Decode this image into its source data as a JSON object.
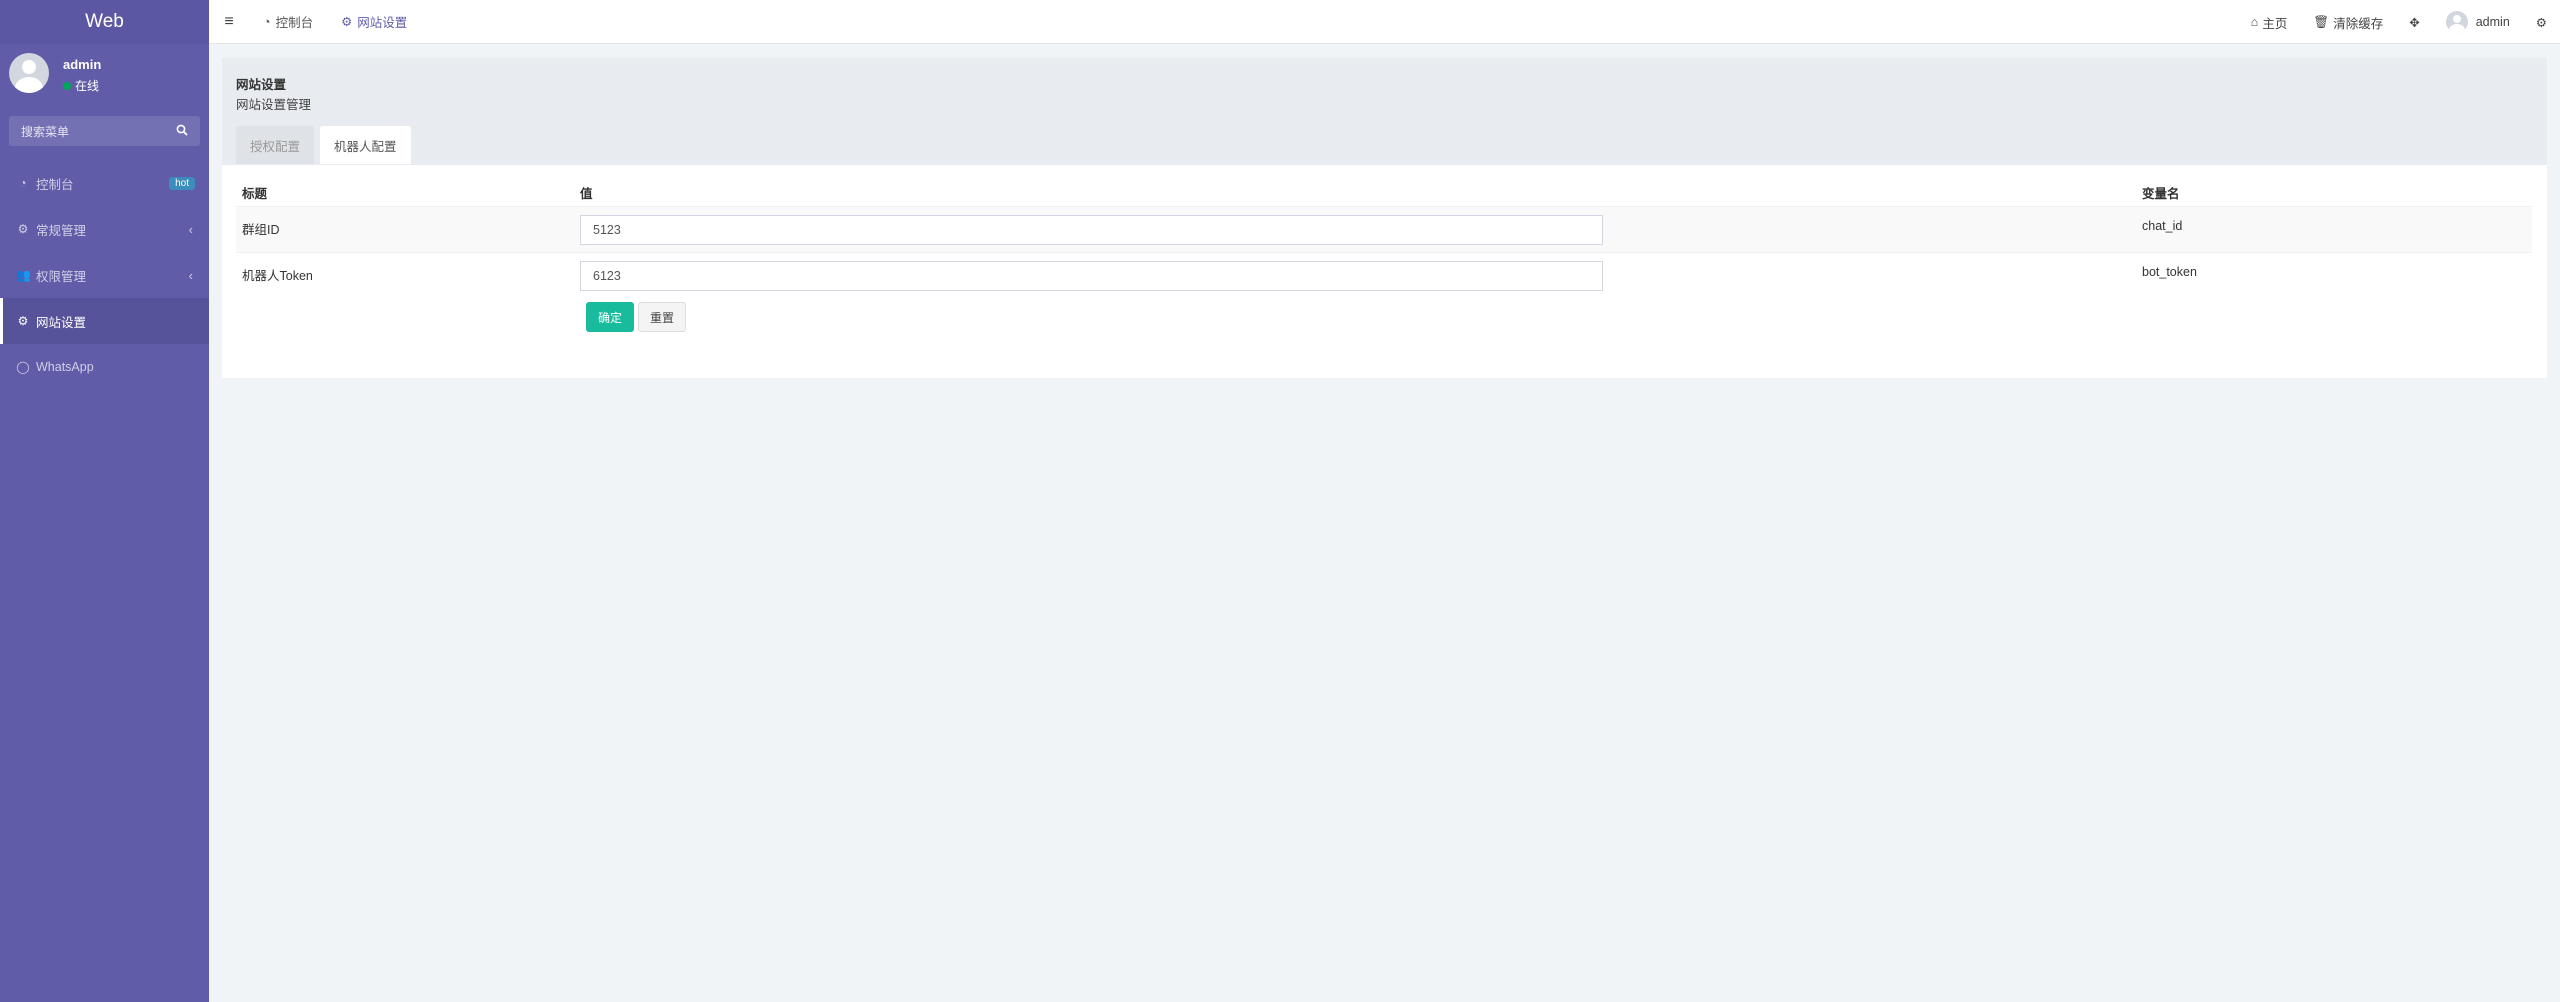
{
  "sidebar": {
    "logo": "Web",
    "user": {
      "name": "admin",
      "status": "在线"
    },
    "search_placeholder": "搜索菜单",
    "items": [
      {
        "label": "控制台",
        "icon": "dashboard-icon",
        "badge": "hot"
      },
      {
        "label": "常规管理",
        "icon": "cogs-icon"
      },
      {
        "label": "权限管理",
        "icon": "users-icon"
      },
      {
        "label": "网站设置",
        "icon": "cogs-icon",
        "active": true
      },
      {
        "label": "WhatsApp",
        "icon": "whatsapp-icon"
      }
    ]
  },
  "topbar": {
    "tabs": [
      {
        "label": "控制台",
        "icon": "dashboard-icon"
      },
      {
        "label": "网站设置",
        "icon": "cogs-icon",
        "active": true
      }
    ],
    "home": "主页",
    "clear_cache": "清除缓存",
    "user": "admin"
  },
  "panel": {
    "title": "网站设置",
    "subtitle": "网站设置管理",
    "tabs": [
      {
        "label": "授权配置"
      },
      {
        "label": "机器人配置",
        "active": true
      }
    ]
  },
  "table": {
    "headers": [
      "标题",
      "值",
      "变量名"
    ],
    "rows": [
      {
        "title": "群组ID",
        "value": "5123",
        "var": "chat_id"
      },
      {
        "title": "机器人Token",
        "value": "6123",
        "var": "bot_token"
      }
    ],
    "submit": "确定",
    "reset": "重置"
  },
  "colors": {
    "sidebar": "#605ca8",
    "accent": "#18bc9c",
    "badge": "#3c8dbc"
  }
}
